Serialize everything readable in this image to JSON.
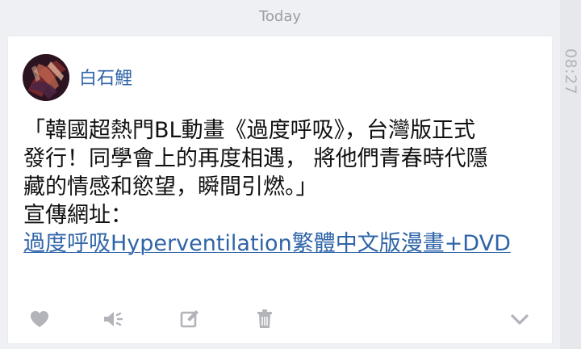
{
  "date_separator": "Today",
  "timestamp": "08:27",
  "message": {
    "sender": "白石鯉",
    "lines": [
      "「韓國超熱門BL動畫《過度呼吸》，台灣版正式",
      "發行！同學會上的再度相遇， 將他們青春時代隱",
      "藏的情感和慾望，瞬間引燃。」",
      "宣傳網址："
    ],
    "link": "過度呼吸Hyperventilation繁體中文版漫畫+DVD"
  },
  "icons": {
    "like": "heart-icon",
    "speak": "speaker-icon",
    "edit": "edit-icon",
    "delete": "trash-icon",
    "more": "chevron-down-icon"
  },
  "colors": {
    "background": "#eff0f4",
    "card": "#ffffff",
    "sender": "#2f64a8",
    "link": "#2f64a8",
    "muted": "#9b9ea6",
    "icon": "#b2b4ba"
  }
}
